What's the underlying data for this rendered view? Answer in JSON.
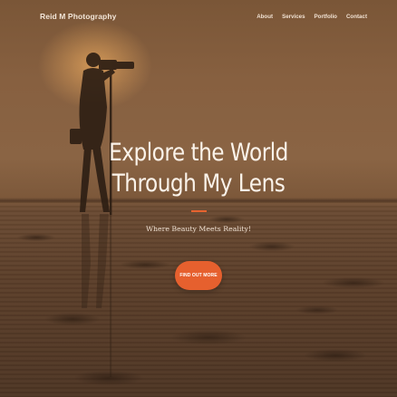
{
  "nav": {
    "brand": "Reid M Photography",
    "links": [
      "About",
      "Services",
      "Portfolio",
      "Contact"
    ]
  },
  "hero": {
    "headline": "Explore the World Through My Lens",
    "tagline": "Where Beauty Meets Reality!",
    "cta_label": "FIND OUT MORE"
  },
  "colors": {
    "accent": "#e6602e",
    "overlay": "#7a5637"
  },
  "icons": {
    "silhouette": "photographer-with-tripod"
  }
}
